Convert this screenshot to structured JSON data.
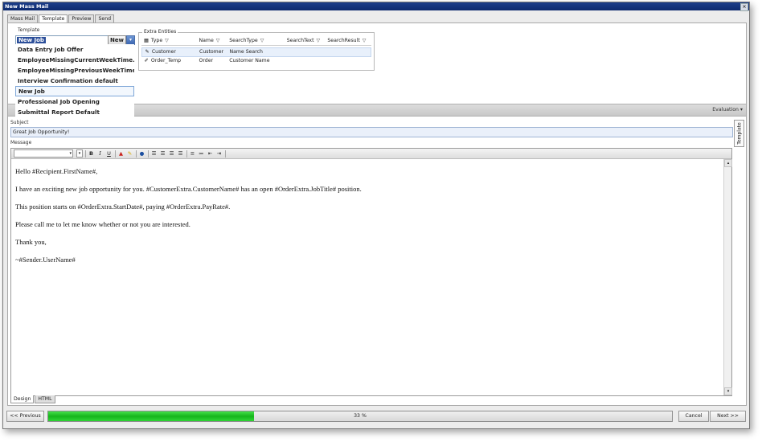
{
  "window": {
    "title": "New Mass Mail",
    "close_glyph": "×"
  },
  "tabs": [
    {
      "label": "Mass Mail"
    },
    {
      "label": "Template"
    },
    {
      "label": "Preview"
    },
    {
      "label": "Send"
    }
  ],
  "template": {
    "group_label": "Template",
    "selected": "New Job",
    "new_label": "New",
    "items": [
      "Data Entry Job Offer",
      "EmployeeMissingCurrentWeekTime...",
      "EmployeeMissingPreviousWeekTime...",
      "Interview Confirmation default",
      "New Job",
      "Professional Job Opening",
      "Submittal Report Default"
    ]
  },
  "extra_entities": {
    "label": "Extra Entities",
    "columns": [
      "Type",
      "Name",
      "SearchType",
      "SearchText",
      "SearchResult"
    ],
    "rows": [
      {
        "type": "Customer",
        "name": "Customer",
        "search_type": "Name Search",
        "search_text": "",
        "search_result": ""
      },
      {
        "type": "Order_Temp",
        "name": "Order",
        "search_type": "Customer Name",
        "search_text": "",
        "search_result": ""
      }
    ]
  },
  "evaluation_label": "Evaluation ▾",
  "subject": {
    "label": "Subject",
    "value": "Great Job Opportunity!"
  },
  "message": {
    "label": "Message",
    "paragraphs": [
      "Hello #Recipient.FirstName#,",
      "I have an exciting new job opportunity for you. #CustomerExtra.CustomerName# has an open #OrderExtra.JobTitle# position.",
      "This position starts on #OrderExtra.StartDate#, paying #OrderExtra.PayRate#.",
      "Please call me to let me know whether or not you are interested.",
      "Thank you,",
      "~#Sender.UserName#"
    ]
  },
  "side_tab_label": "Template",
  "toolbar": {
    "bold": "B",
    "italic": "I",
    "underline": "U"
  },
  "mode_tabs": [
    {
      "label": "Design"
    },
    {
      "label": "HTML"
    }
  ],
  "footer": {
    "previous_label": "<< Previous",
    "progress_percent": 33,
    "progress_text": "33 %",
    "cancel_label": "Cancel",
    "next_label": "Next >>"
  }
}
